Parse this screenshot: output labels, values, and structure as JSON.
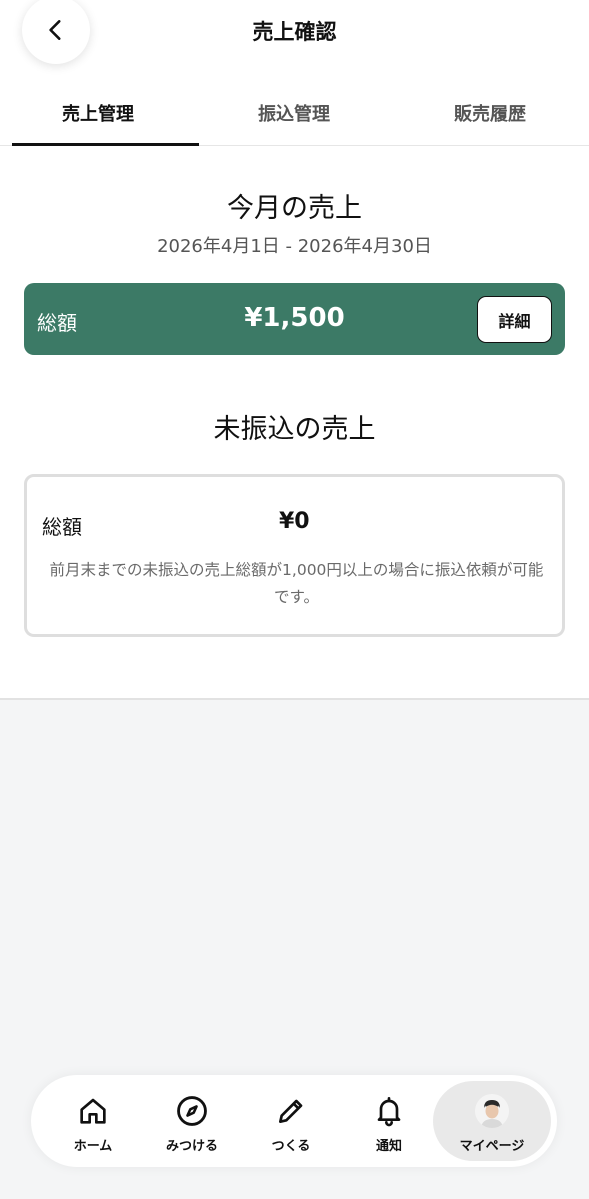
{
  "header": {
    "title": "売上確認"
  },
  "tabs": [
    {
      "label": "売上管理",
      "active": true
    },
    {
      "label": "振込管理",
      "active": false
    },
    {
      "label": "販売履歴",
      "active": false
    }
  ],
  "monthly": {
    "title": "今月の売上",
    "range": "2026年4月1日 - 2026年4月30日",
    "total_label": "総額",
    "total_amount": "¥1,500",
    "detail_label": "詳細"
  },
  "untransferred": {
    "title": "未振込の売上",
    "total_label": "総額",
    "total_amount": "¥0",
    "note": "前月末までの未振込の売上総額が1,000円以上の場合に振込依頼が可能です。"
  },
  "bottom_nav": [
    {
      "label": "ホーム",
      "icon": "home-icon"
    },
    {
      "label": "みつける",
      "icon": "compass-icon"
    },
    {
      "label": "つくる",
      "icon": "pencil-icon"
    },
    {
      "label": "通知",
      "icon": "bell-icon"
    },
    {
      "label": "マイページ",
      "icon": "avatar",
      "active": true
    }
  ],
  "colors": {
    "accent": "#3c7a66",
    "background_lower": "#f4f5f6"
  }
}
